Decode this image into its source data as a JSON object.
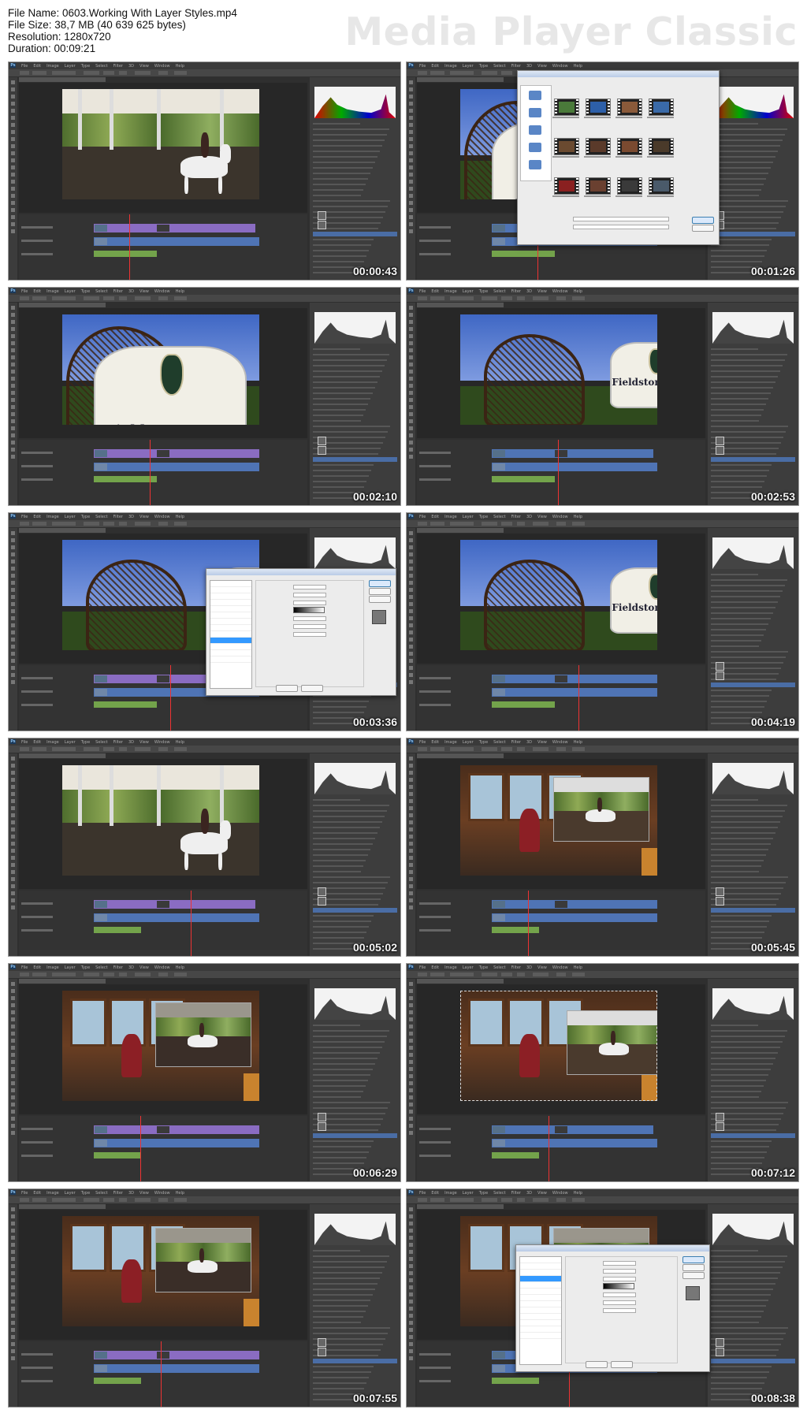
{
  "header": {
    "file_name": "File Name: 0603.Working With Layer Styles.mp4",
    "file_size": "File Size: 38,7 MB (40 639 625 bytes)",
    "resolution": "Resolution: 1280x720",
    "duration": "Duration: 00:09:21",
    "brand": "Media Player Classic"
  },
  "app": {
    "logo": "Ps",
    "menu": [
      "File",
      "Edit",
      "Image",
      "Layer",
      "Type",
      "Select",
      "Filter",
      "3D",
      "View",
      "Window",
      "Help"
    ]
  },
  "frames": [
    {
      "time": "00:00:43",
      "scene": "arena",
      "histogram": "color",
      "dialog": "none"
    },
    {
      "time": "00:01:26",
      "scene": "sign-wide",
      "histogram": "color",
      "dialog": "open-file"
    },
    {
      "time": "00:02:10",
      "scene": "sign-wide",
      "histogram": "gray",
      "dialog": "none",
      "sign_text": "Fieldstone Farm"
    },
    {
      "time": "00:02:53",
      "scene": "sign-far",
      "histogram": "gray",
      "dialog": "none",
      "sign_text": "Fieldstone Farm"
    },
    {
      "time": "00:03:36",
      "scene": "sign-far",
      "histogram": "gray",
      "dialog": "layer-style"
    },
    {
      "time": "00:04:19",
      "scene": "sign-far",
      "histogram": "gray",
      "dialog": "none",
      "sign_text": "Fieldstone Farm"
    },
    {
      "time": "00:05:02",
      "scene": "arena",
      "histogram": "gray",
      "dialog": "none"
    },
    {
      "time": "00:05:45",
      "scene": "room-inset",
      "histogram": "gray",
      "dialog": "none"
    },
    {
      "time": "00:06:29",
      "scene": "room-inset-dark",
      "histogram": "gray",
      "dialog": "none"
    },
    {
      "time": "00:07:12",
      "scene": "room-inset-select",
      "histogram": "gray",
      "dialog": "none"
    },
    {
      "time": "00:07:55",
      "scene": "room-inset-dark",
      "histogram": "gray",
      "dialog": "none"
    },
    {
      "time": "00:08:38",
      "scene": "room-inset-dark",
      "histogram": "gray",
      "dialog": "layer-style-2"
    }
  ],
  "colors": {
    "track_purple": "#8a6cc2",
    "track_blue": "#4f74b5",
    "track_green": "#73a34b",
    "ui_dark": "#2f2f2f"
  }
}
